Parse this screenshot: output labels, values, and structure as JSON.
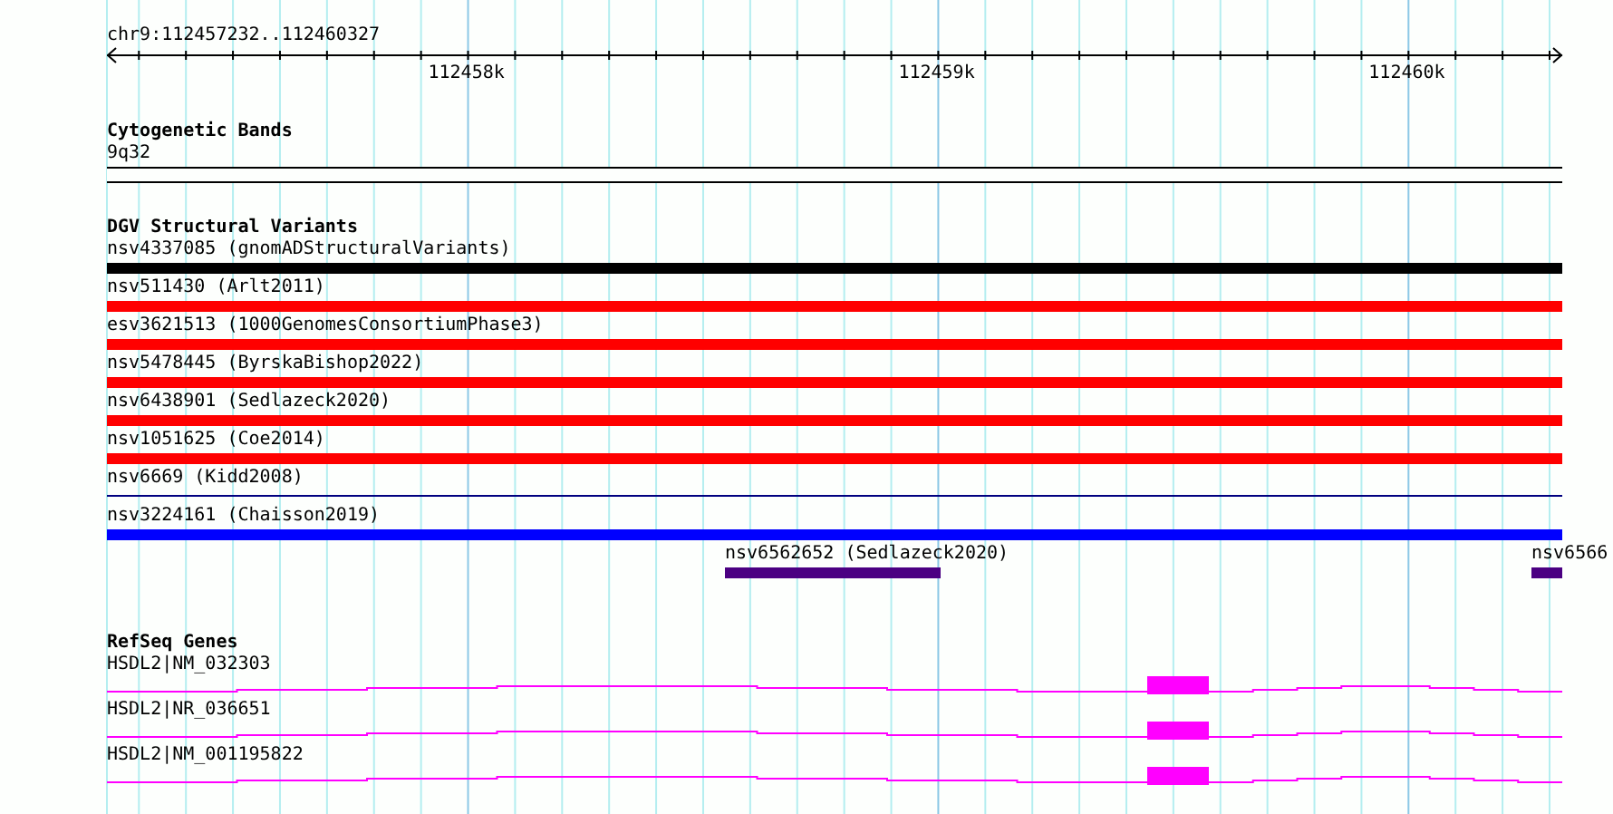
{
  "ruler": {
    "range": "chr9:112457232..112460327",
    "ticks": [
      "112458k",
      "112459k",
      "112460k"
    ]
  },
  "cytogenetic_bands": {
    "title": "Cytogenetic Bands",
    "features": [
      {
        "label": "9q32"
      }
    ]
  },
  "dgv_structural_variants": {
    "title": "DGV Structural Variants",
    "rows": [
      {
        "features": [
          {
            "label": "nsv4337085 (gnomADStructuralVariants)",
            "color": "#000000",
            "kind": "bar"
          }
        ]
      },
      {
        "features": [
          {
            "label": "nsv511430 (Arlt2011)",
            "color": "#ff0000",
            "kind": "bar"
          }
        ]
      },
      {
        "features": [
          {
            "label": "esv3621513 (1000GenomesConsortiumPhase3)",
            "color": "#ff0000",
            "kind": "bar"
          }
        ]
      },
      {
        "features": [
          {
            "label": "nsv5478445 (ByrskaBishop2022)",
            "color": "#ff0000",
            "kind": "bar"
          }
        ]
      },
      {
        "features": [
          {
            "label": "nsv6438901 (Sedlazeck2020)",
            "color": "#ff0000",
            "kind": "bar"
          }
        ]
      },
      {
        "features": [
          {
            "label": "nsv1051625 (Coe2014)",
            "color": "#ff0000",
            "kind": "bar"
          }
        ]
      },
      {
        "features": [
          {
            "label": "nsv6669 (Kidd2008)",
            "color": "#000080",
            "kind": "line"
          }
        ]
      },
      {
        "features": [
          {
            "label": "nsv3224161 (Chaisson2019)",
            "color": "#0000ff",
            "kind": "bar"
          }
        ]
      },
      {
        "features": [
          {
            "label": "nsv6562652 (Sedlazeck2020)",
            "color": "#4b0082",
            "kind": "bar"
          },
          {
            "label": "nsv6566",
            "color": "#4b0082",
            "kind": "bar"
          }
        ]
      }
    ]
  },
  "refseq_genes": {
    "title": "RefSeq Genes",
    "features": [
      {
        "label": "HSDL2|NM_032303"
      },
      {
        "label": "HSDL2|NR_036651"
      },
      {
        "label": "HSDL2|NM_001195822"
      }
    ]
  }
}
